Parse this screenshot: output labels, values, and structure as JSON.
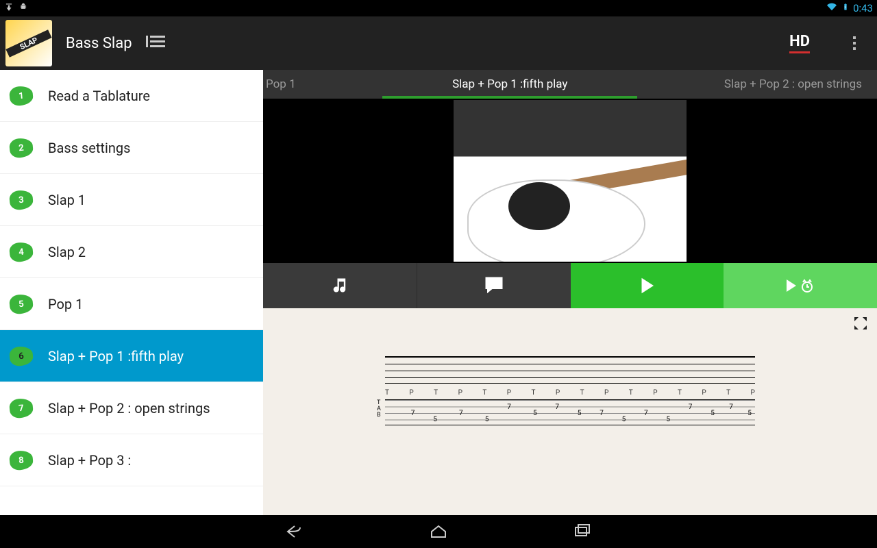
{
  "status": {
    "time": "0:43"
  },
  "app": {
    "title": "Bass Slap",
    "hd_label": "HD"
  },
  "sidebar": {
    "items": [
      {
        "num": "1",
        "label": "Read a Tablature"
      },
      {
        "num": "2",
        "label": "Bass settings"
      },
      {
        "num": "3",
        "label": "Slap 1"
      },
      {
        "num": "4",
        "label": "Slap 2"
      },
      {
        "num": "5",
        "label": "Pop 1"
      },
      {
        "num": "6",
        "label": "Slap + Pop 1 :fifth play"
      },
      {
        "num": "7",
        "label": "Slap + Pop 2 : open strings"
      },
      {
        "num": "8",
        "label": "Slap + Pop 3 :"
      }
    ],
    "selected_index": 5
  },
  "tabs": {
    "prev": "Pop 1",
    "active": "Slap + Pop 1 :fifth play",
    "next": "Slap + Pop 2 : open strings"
  },
  "tablature": {
    "tp_sequence": [
      "T",
      "P",
      "T",
      "P",
      "T",
      "P",
      "T",
      "P",
      "T",
      "P",
      "T",
      "P",
      "T",
      "P",
      "T",
      "P"
    ],
    "tab_numbers": [
      {
        "str": 2,
        "pos": 0.07,
        "v": "7"
      },
      {
        "str": 3,
        "pos": 0.13,
        "v": "5"
      },
      {
        "str": 2,
        "pos": 0.2,
        "v": "7"
      },
      {
        "str": 3,
        "pos": 0.27,
        "v": "5"
      },
      {
        "str": 1,
        "pos": 0.33,
        "v": "7"
      },
      {
        "str": 2,
        "pos": 0.4,
        "v": "5"
      },
      {
        "str": 1,
        "pos": 0.46,
        "v": "7"
      },
      {
        "str": 2,
        "pos": 0.52,
        "v": "5"
      },
      {
        "str": 2,
        "pos": 0.58,
        "v": "7"
      },
      {
        "str": 3,
        "pos": 0.64,
        "v": "5"
      },
      {
        "str": 2,
        "pos": 0.7,
        "v": "7"
      },
      {
        "str": 3,
        "pos": 0.76,
        "v": "5"
      },
      {
        "str": 1,
        "pos": 0.82,
        "v": "7"
      },
      {
        "str": 2,
        "pos": 0.88,
        "v": "5"
      },
      {
        "str": 1,
        "pos": 0.93,
        "v": "7"
      },
      {
        "str": 2,
        "pos": 0.98,
        "v": "5"
      }
    ],
    "tab_label_lines": [
      "T",
      "A",
      "B"
    ]
  }
}
